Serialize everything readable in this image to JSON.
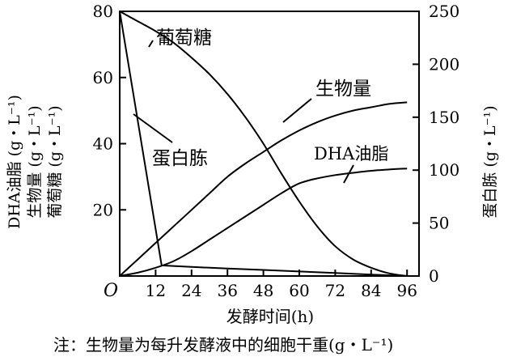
{
  "chart_data": {
    "type": "line",
    "x_axis": {
      "label": "发酵时间(h)",
      "range": [
        0,
        100
      ],
      "ticks": [
        12,
        24,
        36,
        48,
        60,
        72,
        84,
        96
      ],
      "origin_label": "O"
    },
    "y_left": {
      "labels": [
        "DHA油脂 (g・L⁻¹)",
        "生物量 (g・L⁻¹)",
        "葡萄糖 (g・L⁻¹)"
      ],
      "range": [
        0,
        80
      ],
      "ticks": [
        20,
        40,
        60,
        80
      ]
    },
    "y_right": {
      "label": "蛋白胨 (g・L⁻¹)",
      "range": [
        0,
        250
      ],
      "ticks": [
        50,
        100,
        150,
        200,
        250
      ],
      "zero_label": "0"
    },
    "series": [
      {
        "name": "葡萄糖",
        "axis": "left",
        "x": [
          0,
          6,
          12,
          18,
          24,
          30,
          36,
          42,
          48,
          54,
          60,
          66,
          72,
          78,
          84,
          90,
          96
        ],
        "y": [
          80,
          77,
          74,
          70.5,
          66,
          61,
          55,
          48,
          40,
          31,
          22.5,
          15,
          9,
          5,
          2.5,
          0.8,
          0
        ]
      },
      {
        "name": "生物量",
        "axis": "left",
        "x": [
          0,
          6,
          12,
          18,
          24,
          30,
          36,
          42,
          48,
          54,
          60,
          66,
          72,
          78,
          84,
          90,
          96
        ],
        "y": [
          0,
          5,
          10,
          15,
          20,
          25,
          30,
          34,
          37.5,
          41,
          44,
          46.5,
          48.5,
          50,
          51,
          52,
          52.5
        ]
      },
      {
        "name": "DHA油脂",
        "axis": "left",
        "x": [
          0,
          6,
          12,
          18,
          24,
          30,
          36,
          42,
          48,
          54,
          60,
          66,
          72,
          78,
          84,
          90,
          96
        ],
        "y": [
          0,
          1,
          2.5,
          4.5,
          7.5,
          11,
          14.5,
          18,
          21.5,
          25,
          28,
          29.5,
          30.5,
          31.2,
          31.8,
          32.2,
          32.5
        ]
      },
      {
        "name": "蛋白胨",
        "axis": "right",
        "x": [
          0,
          14,
          24,
          36,
          48,
          60,
          72,
          84,
          96
        ],
        "y": [
          250,
          10,
          8.6,
          7.1,
          5.7,
          4.3,
          2.9,
          1.4,
          0
        ]
      }
    ],
    "annotations": [
      "葡萄糖",
      "生物量",
      "DHA油脂",
      "蛋白胨"
    ],
    "note": "注：生物量为每升发酵液中的细胞干重(g・L⁻¹)"
  }
}
